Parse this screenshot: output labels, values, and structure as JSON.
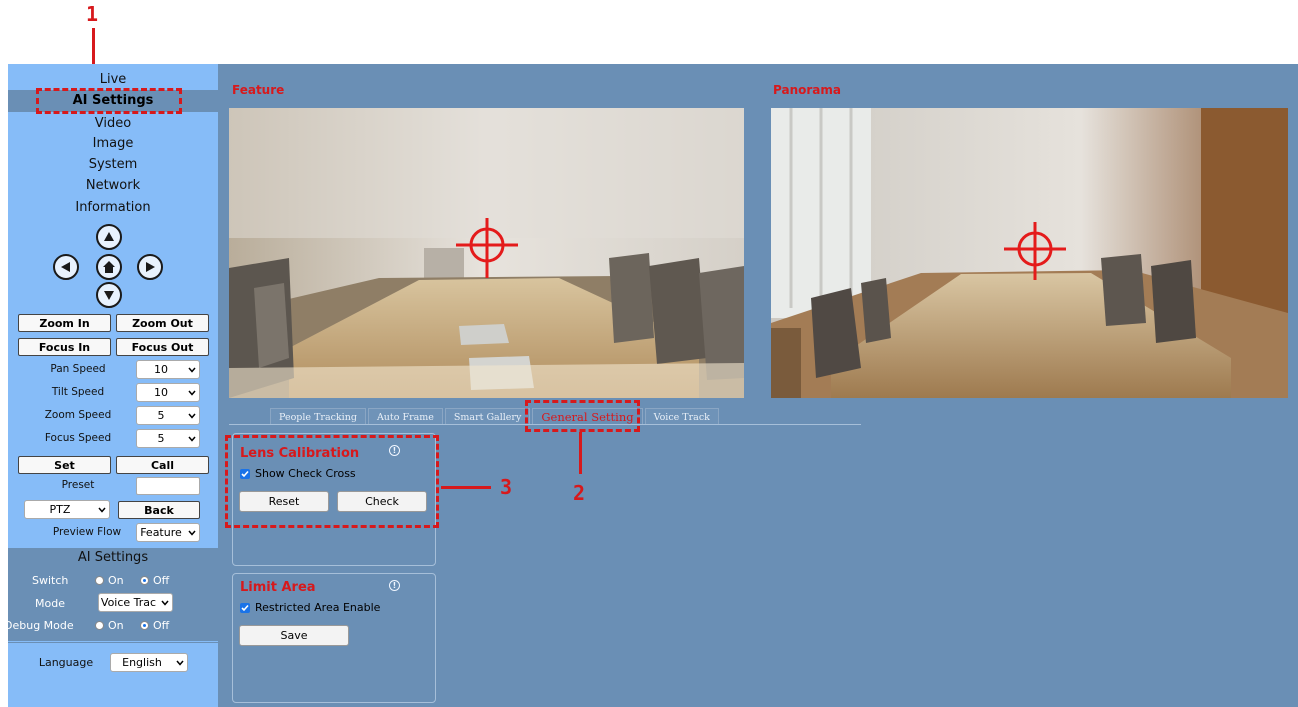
{
  "annotations": {
    "n1": "1",
    "n2": "2",
    "n3": "3"
  },
  "nav": {
    "items": [
      "Live",
      "AI Settings",
      "Video",
      "Image",
      "System",
      "Network",
      "Information"
    ],
    "active": "AI Settings"
  },
  "ptz": {
    "zoom_in": "Zoom In",
    "zoom_out": "Zoom Out",
    "focus_in": "Focus In",
    "focus_out": "Focus Out",
    "pan_speed_label": "Pan Speed",
    "pan_speed": "10",
    "tilt_speed_label": "Tilt Speed",
    "tilt_speed": "10",
    "zoom_speed_label": "Zoom Speed",
    "zoom_speed": "5",
    "focus_speed_label": "Focus Speed",
    "focus_speed": "5",
    "set": "Set",
    "call": "Call",
    "preset_label": "Preset",
    "preset_value": "",
    "mode_select": "PTZ",
    "back": "Back",
    "preview_flow_label": "Preview Flow",
    "preview_flow": "Feature"
  },
  "ai_settings": {
    "title": "AI Settings",
    "switch_label": "Switch",
    "on": "On",
    "off": "Off",
    "switch_value": "Off",
    "mode_label": "Mode",
    "mode_value": "Voice Trac",
    "debug_label": "Debug Mode",
    "debug_value": "Off"
  },
  "language": {
    "label": "Language",
    "value": "English"
  },
  "main": {
    "feature_title": "Feature",
    "panorama_title": "Panorama",
    "tabs": [
      "People Tracking",
      "Auto Frame",
      "Smart Gallery",
      "General Setting",
      "Voice Track"
    ],
    "active_tab": "General Setting",
    "lens": {
      "title": "Lens Calibration",
      "show_check_cross": "Show Check Cross",
      "reset": "Reset",
      "check": "Check"
    },
    "limit": {
      "title": "Limit Area",
      "restricted_enable": "Restricted Area Enable",
      "save": "Save"
    }
  },
  "colors": {
    "sidebar": "#86bcf8",
    "main": "#6a8fb5",
    "accent": "#d7191c",
    "active_nav": "#6a8fb5"
  },
  "icons": [
    "arrow-up-icon",
    "arrow-left-icon",
    "home-icon",
    "arrow-right-icon",
    "arrow-down-icon",
    "info-icon",
    "crosshair-icon",
    "chevron-down-icon",
    "checkbox-checked-icon"
  ]
}
